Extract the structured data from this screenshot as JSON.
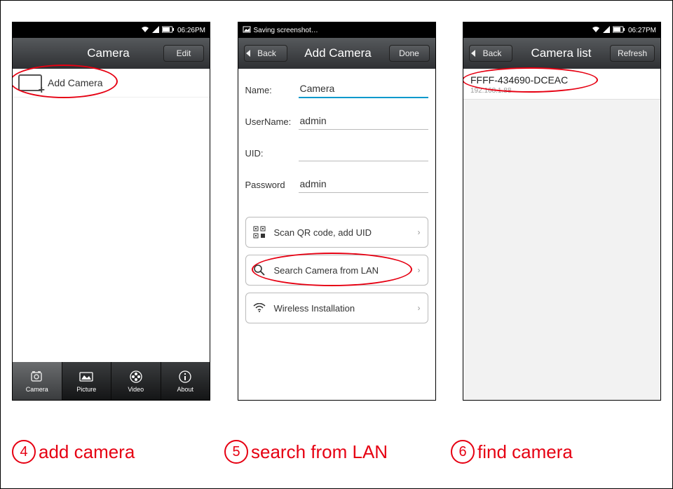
{
  "screen1": {
    "status": {
      "time": "06:26PM"
    },
    "header": {
      "title": "Camera",
      "editBtn": "Edit"
    },
    "addRow": {
      "label": "Add Camera"
    },
    "tabs": {
      "camera": "Camera",
      "picture": "Picture",
      "video": "Video",
      "about": "About"
    }
  },
  "screen2": {
    "status": {
      "toast": "Saving screenshot…"
    },
    "header": {
      "back": "Back",
      "title": "Add Camera",
      "done": "Done"
    },
    "fields": {
      "nameLabel": "Name:",
      "nameVal": "Camera",
      "userLabel": "UserName:",
      "userVal": "admin",
      "uidLabel": "UID:",
      "uidVal": "",
      "pwdLabel": "Password",
      "pwdVal": "admin"
    },
    "actions": {
      "qr": "Scan QR code, add UID",
      "lan": "Search Camera from LAN",
      "wifi": "Wireless Installation"
    }
  },
  "screen3": {
    "status": {
      "time": "06:27PM"
    },
    "header": {
      "back": "Back",
      "title": "Camera list",
      "refresh": "Refresh"
    },
    "item": {
      "uid": "FFFF-434690-DCEAC",
      "ip": "192.168.1.88"
    }
  },
  "captions": {
    "c4num": "4",
    "c4": "add camera",
    "c5num": "5",
    "c5": "search from LAN",
    "c6num": "6",
    "c6": "find camera"
  }
}
